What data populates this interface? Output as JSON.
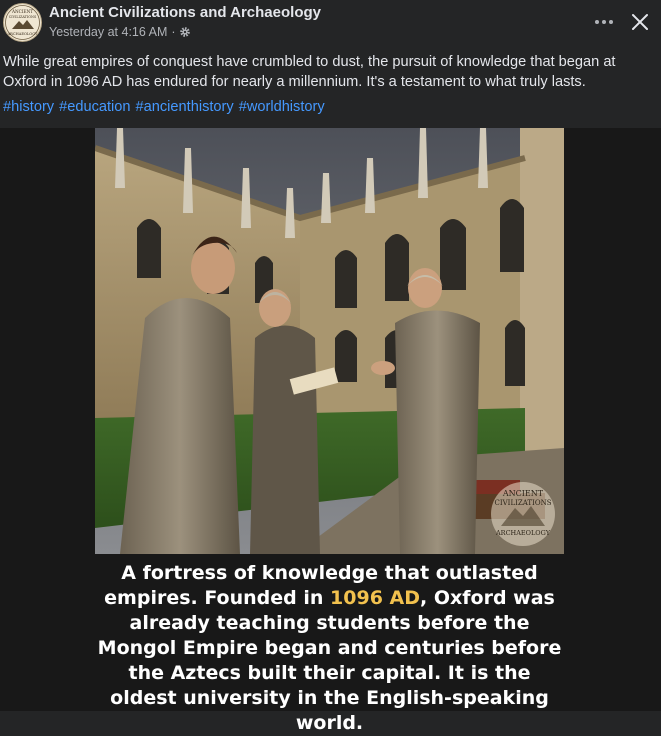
{
  "post": {
    "page_name": "Ancient Civilizations and Archaeology",
    "timestamp": "Yesterday at 4:16 AM",
    "separator": "·",
    "privacy_icon": "gear-icon",
    "body_text": "While great empires of conquest have crumbled to dust, the pursuit of knowledge that began at Oxford in 1096 AD has endured for nearly a millennium. It's a testament to what truly lasts.",
    "hashtags": [
      "#history",
      "#education",
      "#ancienthistory",
      "#worldhistory"
    ]
  },
  "avatar": {
    "line1": "ANCIENT",
    "line2": "CIVILIZATIONS",
    "line3": "ARCHAEOLOGY"
  },
  "watermark": {
    "line1": "ANCIENT",
    "line2": "CIVILIZATIONS",
    "line3": "ARCHAEOLOGY"
  },
  "caption": {
    "before_highlight": "A fortress of knowledge that outlasted empires. Founded in ",
    "highlight": "1096 AD",
    "after_highlight": ", Oxford was already teaching students before the Mongol Empire began and centuries before the Aztecs built their capital. It is the oldest university in the English-speaking world."
  },
  "colors": {
    "background": "#242526",
    "hashtag": "#4599ff",
    "highlight": "#f2c14e",
    "text": "#e4e6eb",
    "secondary_text": "#b0b3b8"
  }
}
